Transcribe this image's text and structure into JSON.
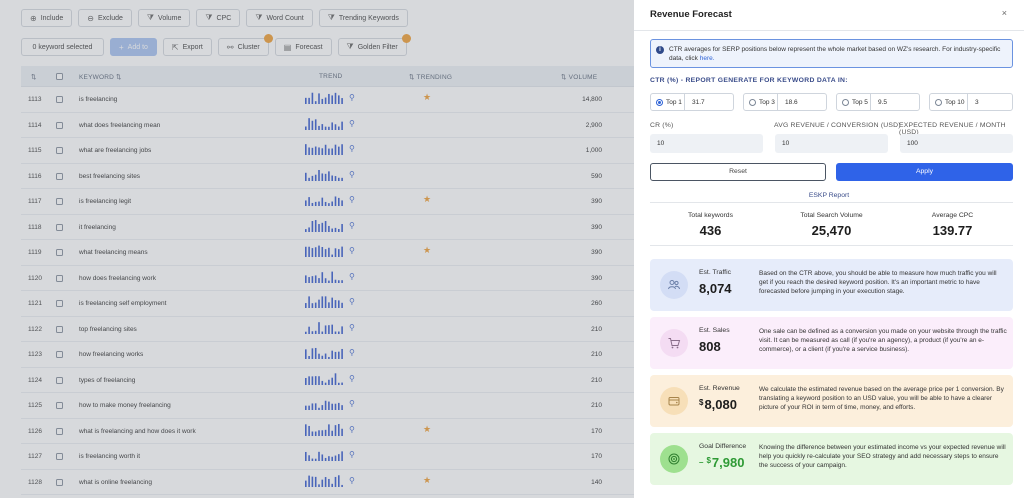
{
  "toolbar": {
    "include": "Include",
    "exclude": "Exclude",
    "volume": "Volume",
    "cpc": "CPC",
    "word_count": "Word Count",
    "trending_keywords": "Trending Keywords",
    "selected": "0 keyword selected",
    "add_to": "Add to",
    "export": "Export",
    "cluster": "Cluster",
    "forecast": "Forecast",
    "golden_filter": "Golden Filter"
  },
  "table": {
    "headers": {
      "keyword": "KEYWORD",
      "trend": "TREND",
      "trending": "TRENDING",
      "volume": "VOLUME"
    },
    "rows": [
      {
        "id": "1113",
        "keyword": "is freelancing",
        "volume": "14,800",
        "trending": true
      },
      {
        "id": "1114",
        "keyword": "what does freelancing mean",
        "volume": "2,900",
        "trending": false
      },
      {
        "id": "1115",
        "keyword": "what are freelancing jobs",
        "volume": "1,000",
        "trending": false
      },
      {
        "id": "1116",
        "keyword": "best freelancing sites",
        "volume": "590",
        "trending": false
      },
      {
        "id": "1117",
        "keyword": "is freelancing legit",
        "volume": "390",
        "trending": true
      },
      {
        "id": "1118",
        "keyword": "it freelancing",
        "volume": "390",
        "trending": false
      },
      {
        "id": "1119",
        "keyword": "what freelancing means",
        "volume": "390",
        "trending": true
      },
      {
        "id": "1120",
        "keyword": "how does freelancing work",
        "volume": "390",
        "trending": false
      },
      {
        "id": "1121",
        "keyword": "is freelancing self employment",
        "volume": "260",
        "trending": false
      },
      {
        "id": "1122",
        "keyword": "top freelancing sites",
        "volume": "210",
        "trending": false
      },
      {
        "id": "1123",
        "keyword": "how freelancing works",
        "volume": "210",
        "trending": false
      },
      {
        "id": "1124",
        "keyword": "types of freelancing",
        "volume": "210",
        "trending": false
      },
      {
        "id": "1125",
        "keyword": "how to make money freelancing",
        "volume": "210",
        "trending": false
      },
      {
        "id": "1126",
        "keyword": "what is freelancing and how does it work",
        "volume": "170",
        "trending": true
      },
      {
        "id": "1127",
        "keyword": "is freelancing worth it",
        "volume": "170",
        "trending": false
      },
      {
        "id": "1128",
        "keyword": "what is online freelancing",
        "volume": "140",
        "trending": true
      }
    ]
  },
  "modal": {
    "title": "Revenue Forecast",
    "close": "×",
    "info_text": "CTR averages for SERP positions below represent the whole market based on WZ's research. For industry-specific data, click",
    "info_link": "here.",
    "ctr_label": "CTR (%) - REPORT GENERATE FOR KEYWORD DATA IN:",
    "tops": [
      {
        "label": "Top 1",
        "value": "31.7",
        "selected": true
      },
      {
        "label": "Top 3",
        "value": "18.6",
        "selected": false
      },
      {
        "label": "Top 5",
        "value": "9.5",
        "selected": false
      },
      {
        "label": "Top 10",
        "value": "3",
        "selected": false
      }
    ],
    "cr_label": "CR (%)",
    "cr_value": "10",
    "avg_rev_label": "AVG REVENUE / CONVERSION (USD)",
    "avg_rev_value": "10",
    "exp_rev_label": "EXPECTED REVENUE / MONTH (USD)",
    "exp_rev_value": "100",
    "reset": "Reset",
    "apply": "Apply",
    "eskp_title": "ESKP Report",
    "stats": [
      {
        "label": "Total keywords",
        "value": "436"
      },
      {
        "label": "Total Search Volume",
        "value": "25,470"
      },
      {
        "label": "Average CPC",
        "value": "139.77"
      }
    ],
    "cards": {
      "traffic": {
        "label": "Est. Traffic",
        "value": "8,074",
        "desc": "Based on the CTR above, you should be able to measure how much traffic you will get if you reach the desired keyword position. It's an important metric to have forecasted before jumping in your execution stage."
      },
      "sales": {
        "label": "Est. Sales",
        "value": "808",
        "desc": "One sale can be defined as a conversion you made on your website through the traffic visit. It can be measured as call (if you're an agency), a product (if you're an e-commerce), or a client (if you're a service business)."
      },
      "revenue": {
        "label": "Est. Revenue",
        "currency": "$",
        "value": "8,080",
        "desc": "We calculate the estimated revenue based on the average price per 1 conversion. By translating a keyword position to an USD value, you will be able to have a clearer picture of your ROI in term of time, money, and efforts."
      },
      "goal": {
        "label": "Goal Difference",
        "sign": "–",
        "currency": "$",
        "value": "7,980",
        "desc": "Knowing the difference between your estimated income vs your expected revenue will help you quickly re-calculate your SEO strategy and add necessary steps to ensure the success of your campaign."
      }
    }
  }
}
